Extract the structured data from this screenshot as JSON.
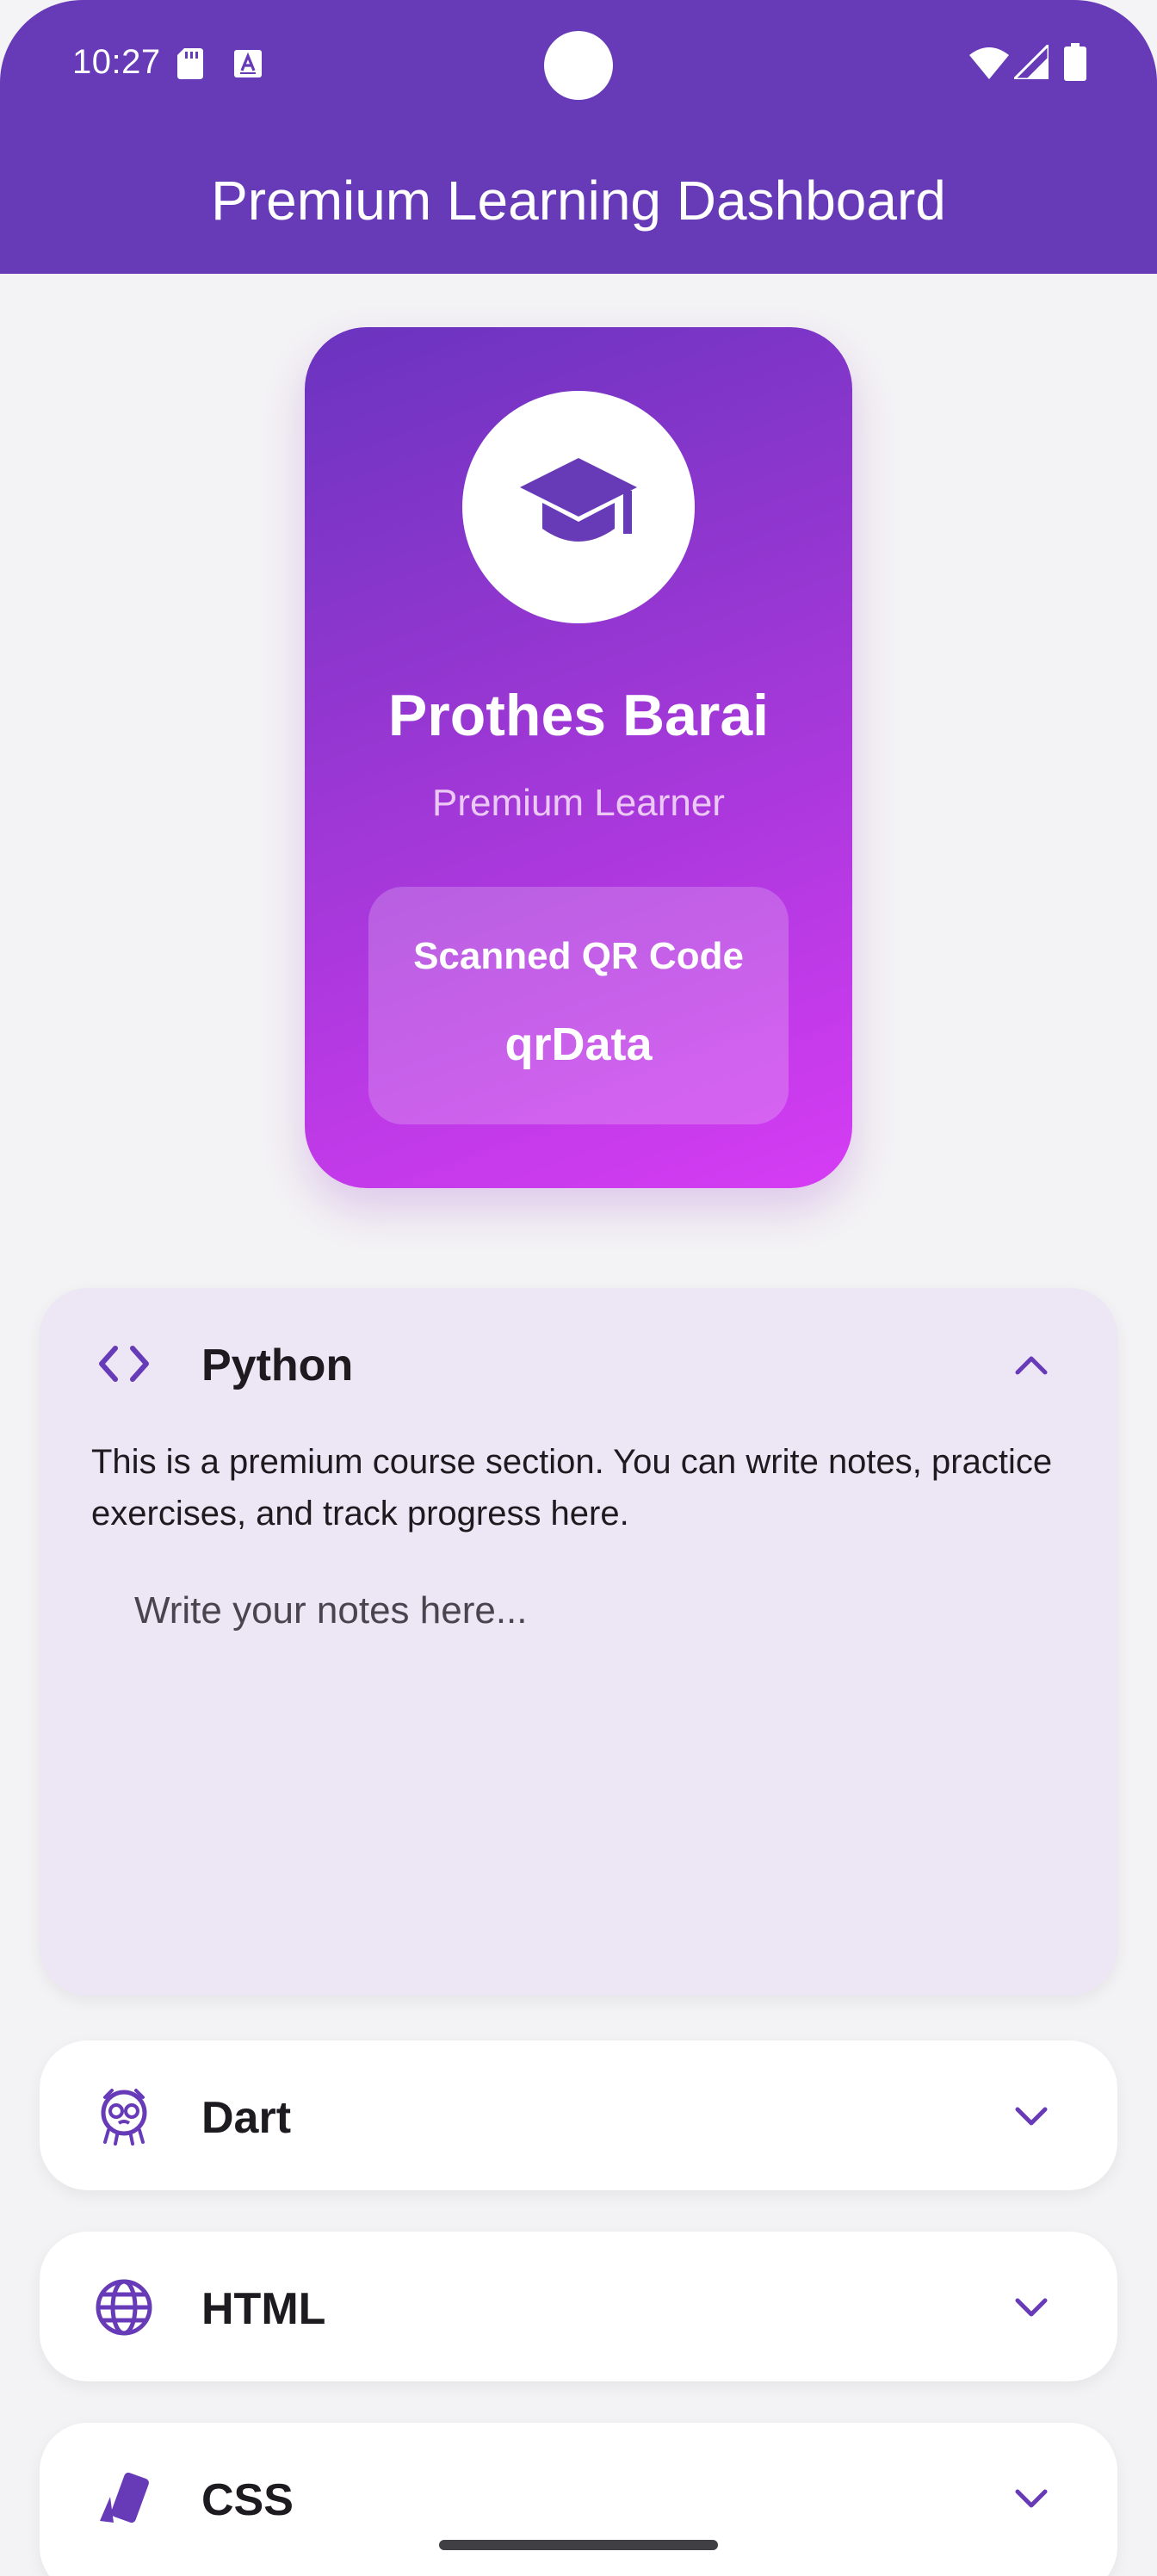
{
  "status_bar": {
    "time": "10:27",
    "icons": [
      "sd-card-icon",
      "a-text-icon",
      "wifi-icon",
      "signal-icon",
      "battery-icon"
    ]
  },
  "app_bar": {
    "title": "Premium Learning Dashboard",
    "color": "#673ab7"
  },
  "profile": {
    "avatar_icon": "graduation-cap-icon",
    "name": "Prothes Barai",
    "role": "Premium Learner",
    "qr": {
      "label": "Scanned QR Code",
      "value": "qrData"
    }
  },
  "courses": [
    {
      "title": "Python",
      "icon": "code-icon",
      "expanded": true,
      "description": "This is a premium course section. You can write notes, practice exercises, and track progress here.",
      "notes_placeholder": "Write your notes here...",
      "notes_value": ""
    },
    {
      "title": "Dart",
      "icon": "dart-mascot-icon",
      "expanded": false
    },
    {
      "title": "HTML",
      "icon": "globe-icon",
      "expanded": false
    },
    {
      "title": "CSS",
      "icon": "style-icon",
      "expanded": false
    }
  ],
  "colors": {
    "accent": "#673ab7",
    "gradient_start": "#6a34bf",
    "gradient_end": "#d63cf4",
    "expanded_panel": "#ede6f4"
  }
}
